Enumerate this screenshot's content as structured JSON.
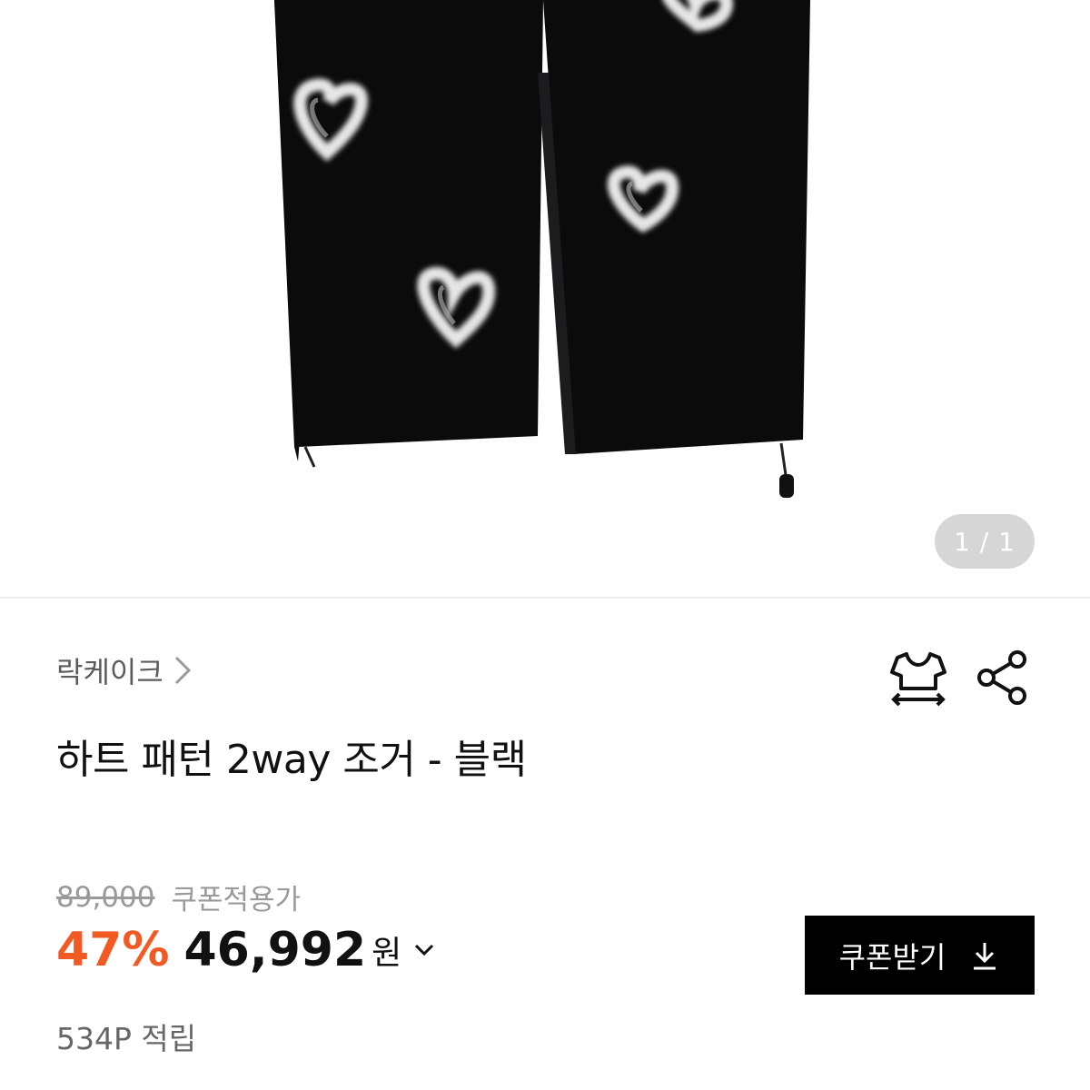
{
  "gallery": {
    "page_indicator": "1 / 1",
    "image_icon": "black-heart-pattern-jogger-pants-image"
  },
  "brand": {
    "name": "락케이크",
    "chevron_icon": "chevron-right-icon"
  },
  "actions": {
    "size_guide_icon": "tshirt-size-guide-icon",
    "share_icon": "share-icon"
  },
  "product": {
    "title": "하트 패턴 2way 조거 - 블랙"
  },
  "price": {
    "original": "89,000",
    "coupon_label": "쿠폰적용가",
    "discount_rate": "47%",
    "final": "46,992",
    "currency": "원",
    "dropdown_icon": "chevron-down-icon"
  },
  "coupon_button": {
    "label": "쿠폰받기",
    "icon": "download-icon"
  },
  "points": {
    "text": "534P 적립"
  },
  "colors": {
    "discount": "#f25a23",
    "button_bg": "#000000",
    "indicator_bg": "#d6d6d6",
    "muted_text": "#9a9a9a"
  }
}
